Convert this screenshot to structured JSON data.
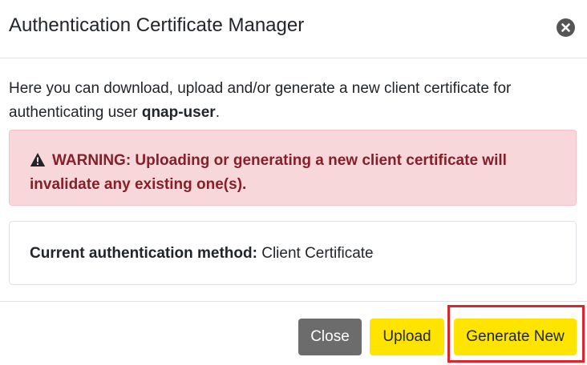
{
  "dialog": {
    "title": "Authentication Certificate Manager"
  },
  "intro": {
    "text_before": "Here you can download, upload and/or generate a new client certificate for authenticating user ",
    "username": "qnap-user",
    "text_after": "."
  },
  "warning": {
    "icon": "warning-triangle-icon",
    "text": "WARNING: Uploading or generating a new client certificate will invalidate any existing one(s).",
    "color": "#842029",
    "background": "#f8d7da"
  },
  "auth_method": {
    "label": "Current authentication method:",
    "value": "Client Certificate"
  },
  "footer": {
    "close_label": "Close",
    "upload_label": "Upload",
    "generate_label": "Generate New"
  },
  "colors": {
    "accent_yellow": "#ffe400",
    "close_gray": "#6c6c6c",
    "highlight_red": "#e0242b"
  }
}
